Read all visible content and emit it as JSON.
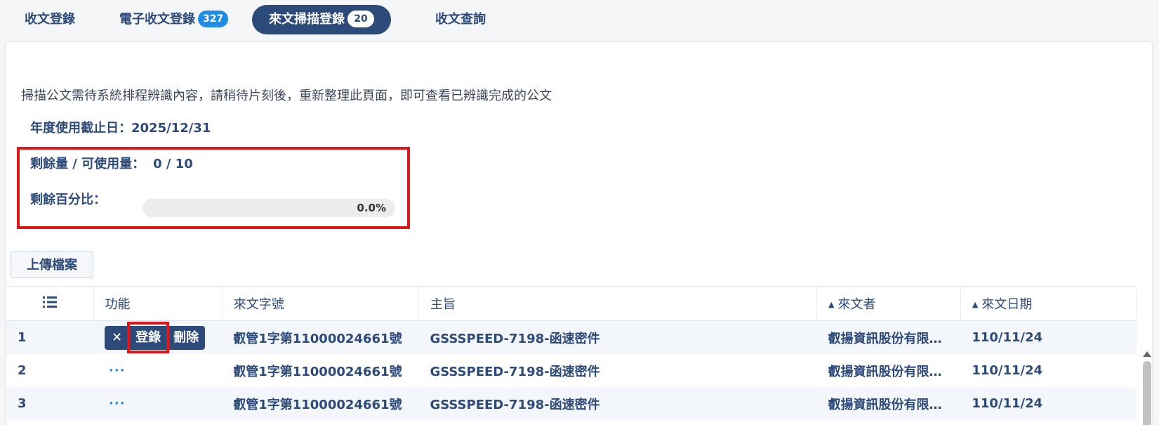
{
  "tabs": [
    {
      "label": "收文登錄"
    },
    {
      "label": "電子收文登錄",
      "badge": "327"
    },
    {
      "label": "來文掃描登錄",
      "badge": "20"
    },
    {
      "label": "收文查詢"
    }
  ],
  "notice": "掃描公文需待系統排程辨識內容，請稍待片刻後，重新整理此頁面，即可查看已辨識完成的公文",
  "quota": {
    "deadline_label": "年度使用截止日：",
    "deadline_value": "2025/12/31",
    "remaining_label": "剩餘量 / 可使用量：",
    "remaining_value": "0 / 10",
    "percent_label": "剩餘百分比：",
    "percent_text": "0.0%",
    "percent_value": 0.0
  },
  "upload_label": "上傳檔案",
  "table": {
    "headers": [
      "功能",
      "來文字號",
      "主旨",
      "來文者",
      "來文日期"
    ],
    "actions": {
      "close": "✕",
      "register": "登錄",
      "delete": "刪除",
      "more": "···"
    },
    "rows": [
      {
        "no": "1",
        "doc_no": "叡管1字第11000024661號",
        "subject": "GSSSPEED-7198-函速密件",
        "sender": "叡揚資訊股份有限…",
        "date": "110/11/24"
      },
      {
        "no": "2",
        "doc_no": "叡管1字第11000024661號",
        "subject": "GSSSPEED-7198-函速密件",
        "sender": "叡揚資訊股份有限…",
        "date": "110/11/24"
      },
      {
        "no": "3",
        "doc_no": "叡管1字第11000024661號",
        "subject": "GSSSPEED-7198-函速密件",
        "sender": "叡揚資訊股份有限…",
        "date": "110/11/24"
      }
    ]
  },
  "colors": {
    "primary": "#2c4a7a",
    "accent": "#1f8ce6",
    "highlight": "#e0161b"
  },
  "icons": {
    "column_toggle": "list-ordered-icon",
    "sort": "sort-icon",
    "close": "close-icon"
  }
}
